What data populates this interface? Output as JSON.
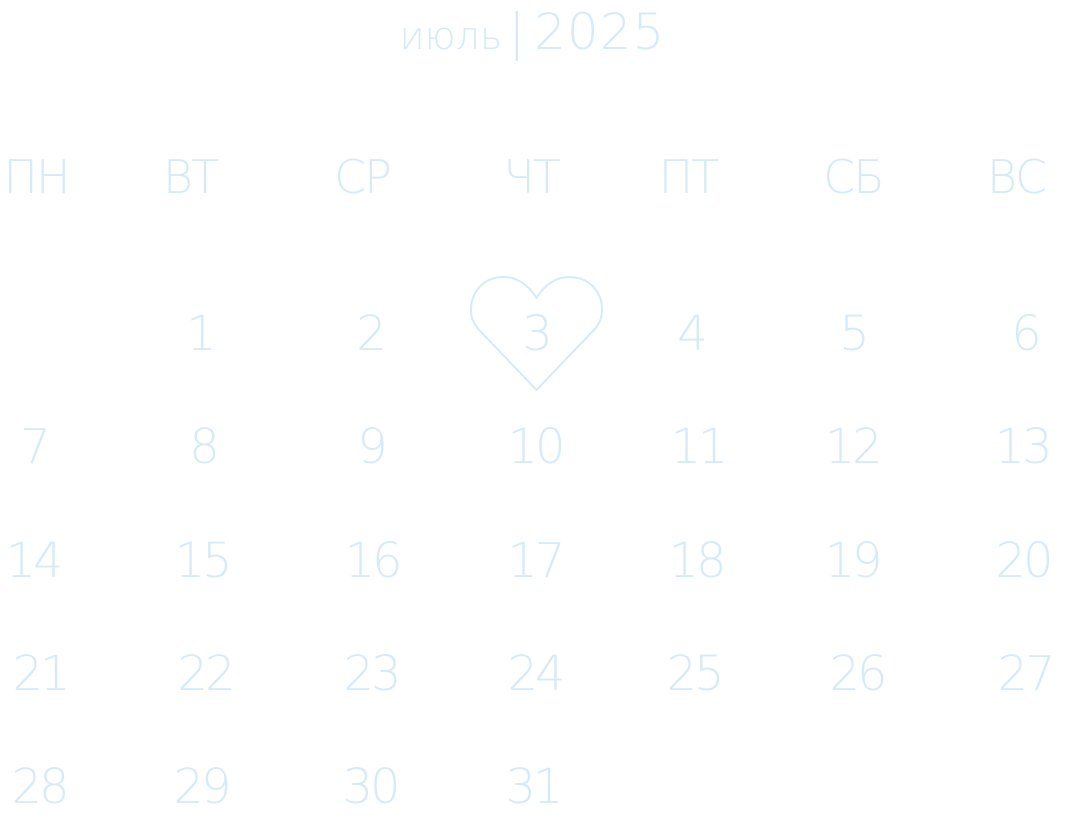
{
  "header": {
    "month": "июль",
    "separator": "|",
    "year": "2025"
  },
  "weekdays": [
    "ПН",
    "ВТ",
    "СР",
    "ЧТ",
    "ПТ",
    "СБ",
    "ВС"
  ],
  "days": [
    "1",
    "2",
    "3",
    "4",
    "5",
    "6",
    "7",
    "8",
    "9",
    "10",
    "11",
    "12",
    "13",
    "14",
    "15",
    "16",
    "17",
    "18",
    "19",
    "20",
    "21",
    "22",
    "23",
    "24",
    "25",
    "26",
    "27",
    "28",
    "29",
    "30",
    "31"
  ],
  "highlighted_day": "3",
  "colors": {
    "text": "#d6ebf7",
    "heart_stroke": "#d6ebf7",
    "background": "#ffffff"
  },
  "icons": {
    "highlight": "heart-icon"
  }
}
